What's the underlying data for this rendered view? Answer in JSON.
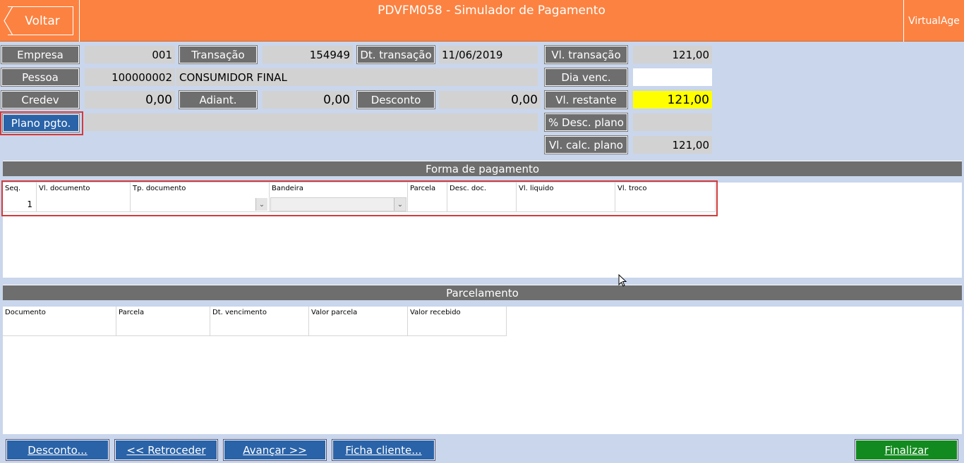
{
  "header": {
    "back_label": "Voltar",
    "title": "PDVFM058 - Simulador de Pagamento",
    "brand_label": "VirtualAge",
    "accent": "#fc8241"
  },
  "fields": {
    "empresa_label": "Empresa",
    "empresa_value": "001",
    "transacao_label": "Transação",
    "transacao_value": "154949",
    "dt_transacao_label": "Dt. transação",
    "dt_transacao_value": "11/06/2019",
    "vl_transacao_label": "Vl. transação",
    "vl_transacao_value": "121,00",
    "pessoa_label": "Pessoa",
    "pessoa_code": "100000002",
    "pessoa_name": "CONSUMIDOR FINAL",
    "dia_venc_label": "Dia venc.",
    "dia_venc_value": "",
    "credev_label": "Credev",
    "credev_value": "0,00",
    "adiant_label": "Adiant.",
    "adiant_value": "0,00",
    "desconto_label": "Desconto",
    "desconto_value": "0,00",
    "vl_restante_label": "Vl. restante",
    "vl_restante_value": "121,00",
    "plano_pgto_label": "Plano pgto.",
    "plano_pgto_value": "",
    "desc_plano_label": "% Desc. plano",
    "desc_plano_value": "",
    "vl_calc_plano_label": "Vl. calc. plano",
    "vl_calc_plano_value": "121,00"
  },
  "forma_pagamento": {
    "title": "Forma de pagamento",
    "columns": [
      "Seq.",
      "Vl. documento",
      "Tp. documento",
      "Bandeira",
      "Parcela",
      "Desc. doc.",
      "Vl. liquido",
      "Vl. troco"
    ],
    "row": {
      "seq": "1"
    }
  },
  "parcelamento": {
    "title": "Parcelamento",
    "columns": [
      "Documento",
      "Parcela",
      "Dt. vencimento",
      "Valor parcela",
      "Valor recebido"
    ]
  },
  "footer": {
    "desconto_btn": "Desconto...",
    "retroceder_btn": "<< Retroceder",
    "avancar_btn": "Avançar >>",
    "ficha_btn": "Ficha cliente...",
    "finalizar_btn": "Finalizar"
  }
}
